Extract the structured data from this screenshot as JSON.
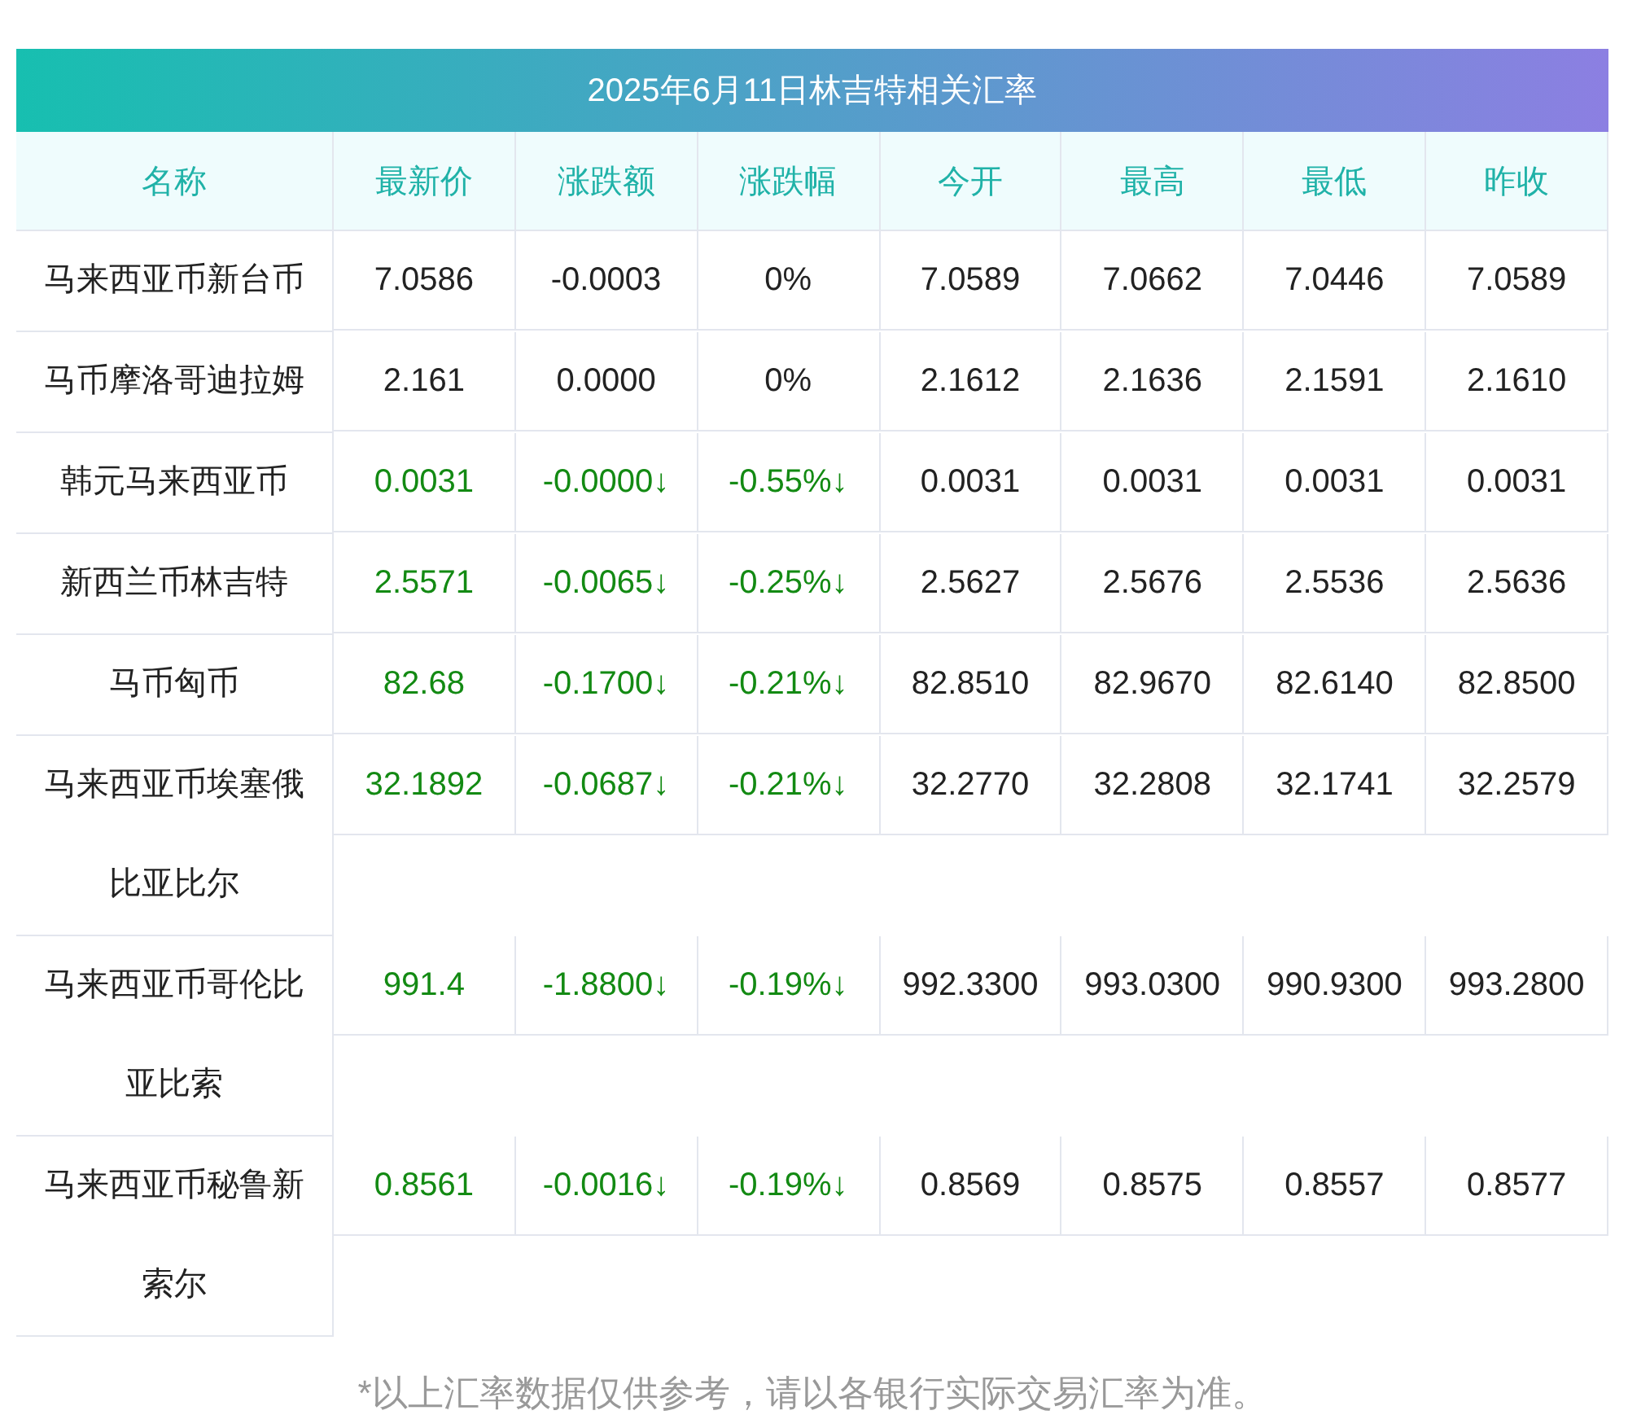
{
  "title": "2025年6月11日林吉特相关汇率",
  "columns": [
    "名称",
    "最新价",
    "涨跌额",
    "涨跌幅",
    "今开",
    "最高",
    "最低",
    "昨收"
  ],
  "rows": [
    {
      "name": "马来西亚币新台币",
      "falling": false,
      "values": [
        "7.0586",
        "-0.0003",
        "0%",
        "7.0589",
        "7.0662",
        "7.0446",
        "7.0589"
      ]
    },
    {
      "name": "马币摩洛哥迪拉姆",
      "falling": false,
      "values": [
        "2.161",
        "0.0000",
        "0%",
        "2.1612",
        "2.1636",
        "2.1591",
        "2.1610"
      ]
    },
    {
      "name": "韩元马来西亚币",
      "falling": true,
      "values": [
        "0.0031",
        "-0.0000↓",
        "-0.55%↓",
        "0.0031",
        "0.0031",
        "0.0031",
        "0.0031"
      ]
    },
    {
      "name": "新西兰币林吉特",
      "falling": true,
      "values": [
        "2.5571",
        "-0.0065↓",
        "-0.25%↓",
        "2.5627",
        "2.5676",
        "2.5536",
        "2.5636"
      ]
    },
    {
      "name": "马币匈币",
      "falling": true,
      "values": [
        "82.68",
        "-0.1700↓",
        "-0.21%↓",
        "82.8510",
        "82.9670",
        "82.6140",
        "82.8500"
      ]
    },
    {
      "name": "马来西亚币埃塞俄比亚比尔",
      "falling": true,
      "values": [
        "32.1892",
        "-0.0687↓",
        "-0.21%↓",
        "32.2770",
        "32.2808",
        "32.1741",
        "32.2579"
      ]
    },
    {
      "name": "马来西亚币哥伦比亚比索",
      "falling": true,
      "values": [
        "991.4",
        "-1.8800↓",
        "-0.19%↓",
        "992.3300",
        "993.0300",
        "990.9300",
        "993.2800"
      ]
    },
    {
      "name": "马来西亚币秘鲁新索尔",
      "falling": true,
      "values": [
        "0.8561",
        "-0.0016↓",
        "-0.19%↓",
        "0.8569",
        "0.8575",
        "0.8557",
        "0.8577"
      ]
    }
  ],
  "footnote": "*以上汇率数据仅供参考，请以各银行实际交易汇率为准。"
}
